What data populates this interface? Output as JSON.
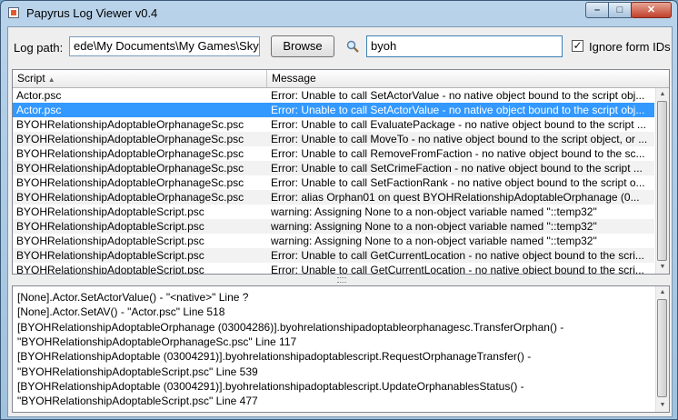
{
  "window": {
    "title": "Papyrus Log Viewer v0.4",
    "controls": {
      "minimize": "–",
      "maximize": "□",
      "close": "✕"
    }
  },
  "toolbar": {
    "log_path_label": "Log path:",
    "log_path_value": "ede\\My Documents\\My Games\\Skyrim",
    "browse_label": "Browse",
    "search_icon": "magnifier-icon",
    "filter_value": "byoh",
    "ignore_checked": true,
    "ignore_label": "Ignore form IDs"
  },
  "table": {
    "columns": {
      "script": "Script",
      "message": "Message"
    },
    "sort_indicator": "▲",
    "selected_index": 1,
    "rows": [
      {
        "script": "Actor.psc",
        "message": "Error: Unable to call SetActorValue - no native object bound to the script obj..."
      },
      {
        "script": "Actor.psc",
        "message": "Error: Unable to call SetActorValue - no native object bound to the script obj..."
      },
      {
        "script": "BYOHRelationshipAdoptableOrphanageSc.psc",
        "message": "Error: Unable to call EvaluatePackage - no native object bound to the script ..."
      },
      {
        "script": "BYOHRelationshipAdoptableOrphanageSc.psc",
        "message": "Error: Unable to call MoveTo - no native object bound to the script object, or ..."
      },
      {
        "script": "BYOHRelationshipAdoptableOrphanageSc.psc",
        "message": "Error: Unable to call RemoveFromFaction - no native object bound to the sc..."
      },
      {
        "script": "BYOHRelationshipAdoptableOrphanageSc.psc",
        "message": "Error: Unable to call SetCrimeFaction - no native object bound to the script ..."
      },
      {
        "script": "BYOHRelationshipAdoptableOrphanageSc.psc",
        "message": "Error: Unable to call SetFactionRank - no native object bound to the script o..."
      },
      {
        "script": "BYOHRelationshipAdoptableOrphanageSc.psc",
        "message": "Error: alias Orphan01 on quest BYOHRelationshipAdoptableOrphanage (0..."
      },
      {
        "script": "BYOHRelationshipAdoptableScript.psc",
        "message": "warning: Assigning None to a non-object variable named \"::temp32\""
      },
      {
        "script": "BYOHRelationshipAdoptableScript.psc",
        "message": "warning: Assigning None to a non-object variable named \"::temp32\""
      },
      {
        "script": "BYOHRelationshipAdoptableScript.psc",
        "message": "warning: Assigning None to a non-object variable named \"::temp32\""
      },
      {
        "script": "BYOHRelationshipAdoptableScript.psc",
        "message": "Error: Unable to call GetCurrentLocation - no native object bound to the scri..."
      },
      {
        "script": "BYOHRelationshipAdoptableScript.psc",
        "message": "Error: Unable to call GetCurrentLocation - no native object bound to the scri..."
      }
    ]
  },
  "stack_trace": [
    "[None].Actor.SetActorValue() - \"<native>\" Line ?",
    "[None].Actor.SetAV() - \"Actor.psc\" Line 518",
    "[BYOHRelationshipAdoptableOrphanage (03004286)].byohrelationshipadoptableorphanagesc.TransferOrphan() -",
    "\"BYOHRelationshipAdoptableOrphanageSc.psc\" Line 117",
    "[BYOHRelationshipAdoptable (03004291)].byohrelationshipadoptablescript.RequestOrphanageTransfer() -",
    "\"BYOHRelationshipAdoptableScript.psc\" Line 539",
    "[BYOHRelationshipAdoptable (03004291)].byohrelationshipadoptablescript.UpdateOrphanablesStatus() -",
    "\"BYOHRelationshipAdoptableScript.psc\" Line 477"
  ],
  "colors": {
    "selection": "#3399ff",
    "title_bar": "#b9d3ea"
  }
}
